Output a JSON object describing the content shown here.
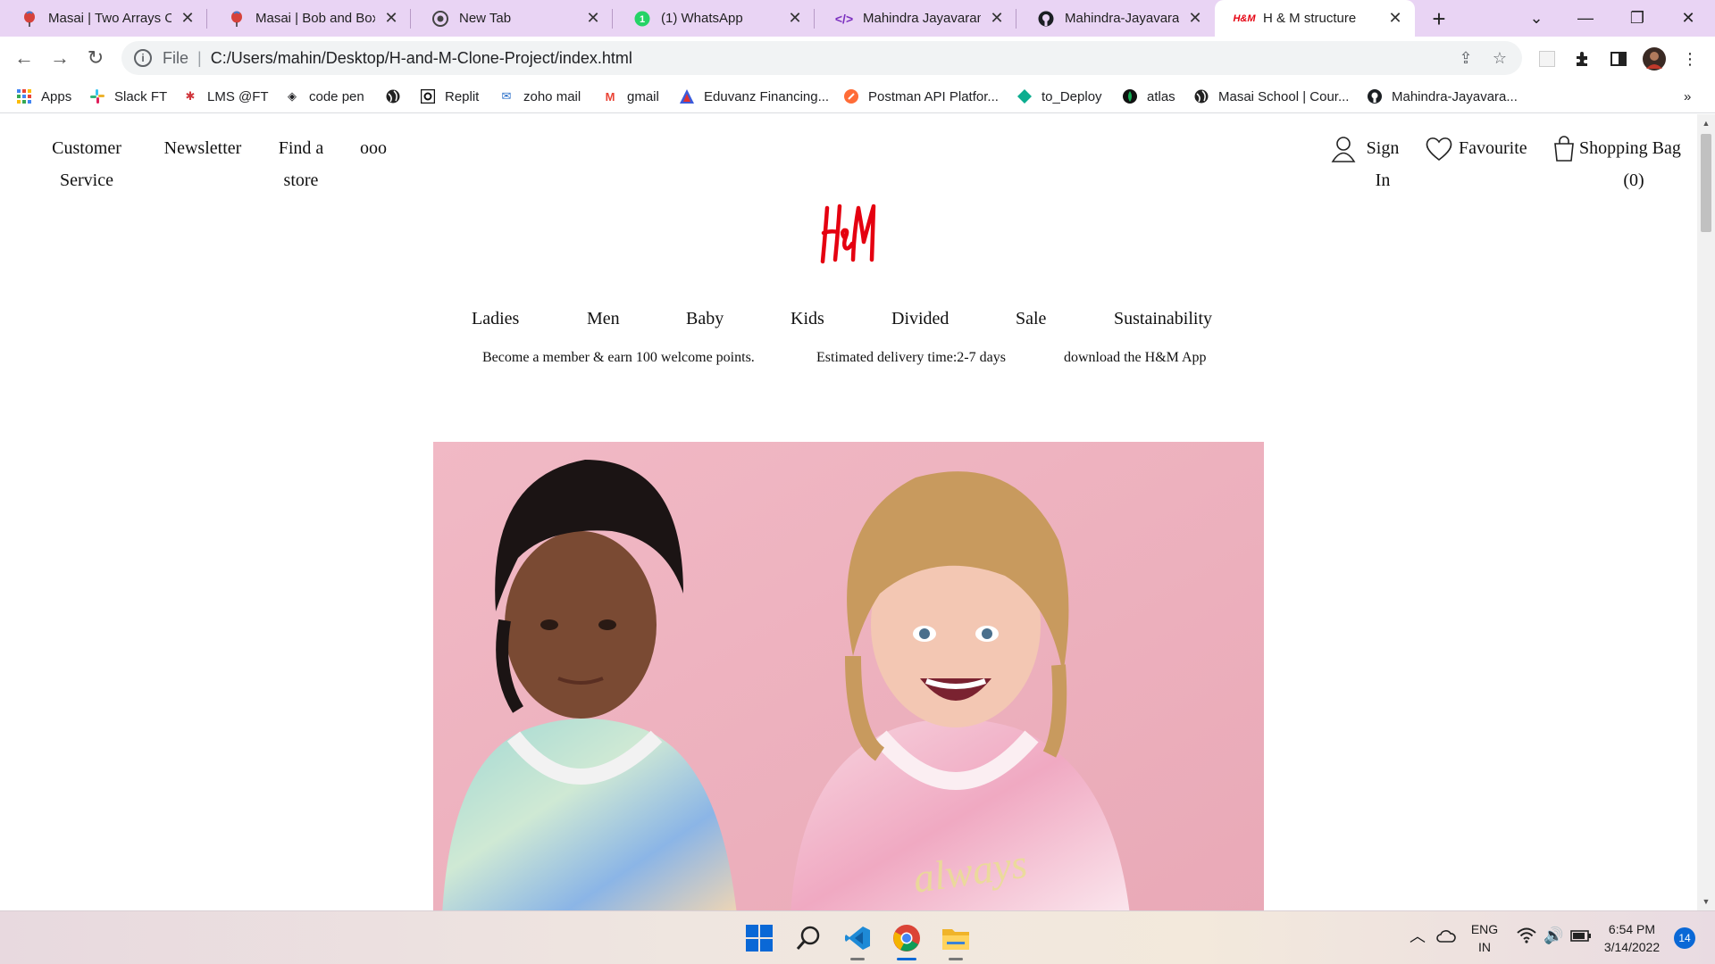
{
  "browser": {
    "tabs": [
      {
        "title": "Masai | Two Arrays Or",
        "favicon": "masai-balloon-icon"
      },
      {
        "title": "Masai | Bob and Boxe",
        "favicon": "masai-balloon-icon"
      },
      {
        "title": "New Tab",
        "favicon": "chrome-icon"
      },
      {
        "title": "(1) WhatsApp",
        "favicon": "whatsapp-icon"
      },
      {
        "title": "Mahindra Jayavaram |",
        "favicon": "code-icon"
      },
      {
        "title": "Mahindra-Jayavaram/",
        "favicon": "github-icon"
      },
      {
        "title": "H & M structure",
        "favicon": "hm-logo-icon",
        "active": true
      }
    ],
    "address": {
      "scheme_label": "File",
      "url": "C:/Users/mahin/Desktop/H-and-M-Clone-Project/index.html"
    },
    "bookmarks": [
      {
        "label": "Apps",
        "icon": "apps-grid-icon"
      },
      {
        "label": "Slack FT",
        "icon": "slack-icon"
      },
      {
        "label": "LMS @FT",
        "icon": "lms-icon"
      },
      {
        "label": "code pen",
        "icon": "codepen-icon"
      },
      {
        "label": "",
        "icon": "globe-icon"
      },
      {
        "label": "Replit",
        "icon": "replit-icon"
      },
      {
        "label": "zoho mail",
        "icon": "mail-icon"
      },
      {
        "label": "gmail",
        "icon": "gmail-icon"
      },
      {
        "label": "Eduvanz Financing...",
        "icon": "eduvanz-icon"
      },
      {
        "label": "Postman API Platfor...",
        "icon": "postman-icon"
      },
      {
        "label": "to_Deploy",
        "icon": "diamond-icon"
      },
      {
        "label": "atlas",
        "icon": "leaf-icon"
      },
      {
        "label": "Masai School | Cour...",
        "icon": "globe-icon"
      },
      {
        "label": "Mahindra-Jayavara...",
        "icon": "github-icon"
      }
    ],
    "more_bookmarks": "»"
  },
  "page": {
    "header_links": {
      "customer_service_line1": "Customer",
      "customer_service_line2": "Service",
      "newsletter": "Newsletter",
      "find_store_line1": "Find a",
      "find_store_line2": "store",
      "more": "ooo"
    },
    "account": {
      "sign_in_line1": "Sign",
      "sign_in_line2": "In",
      "favourite": "Favourite",
      "shopping_bag": "Shopping Bag",
      "bag_count": "(0)"
    },
    "menu": [
      "Ladies",
      "Men",
      "Baby",
      "Kids",
      "Divided",
      "Sale",
      "Sustainability"
    ],
    "info_bar": [
      "Become a member & earn 100 welcome points.",
      "Estimated delivery time:2-7 days",
      "download the H&M App"
    ],
    "hero_text": "always"
  },
  "taskbar": {
    "apps": [
      "windows-start-icon",
      "search-icon",
      "vscode-icon",
      "chrome-icon",
      "file-explorer-icon"
    ],
    "language_line1": "ENG",
    "language_line2": "IN",
    "time": "6:54 PM",
    "date": "3/14/2022",
    "notification_count": "14"
  },
  "colors": {
    "tab_strip": "#e9d4f4",
    "hm_red": "#e50010",
    "hero_pink": "#eeb3c0"
  }
}
